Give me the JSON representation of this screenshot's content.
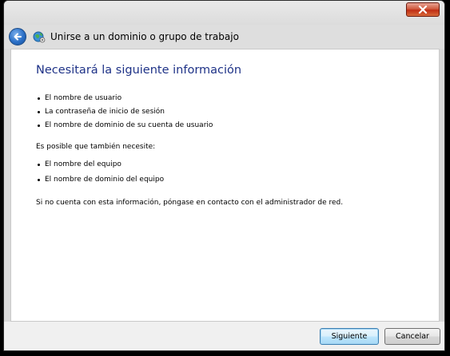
{
  "window": {
    "title": "Unirse a un dominio o grupo de trabajo"
  },
  "icons": {
    "close": "close-icon",
    "back": "back-arrow-icon",
    "app": "network-globe-icon"
  },
  "content": {
    "heading": "Necesitará la siguiente información",
    "required_items": [
      "El nombre de usuario",
      "La contraseña de inicio de sesión",
      "El nombre de dominio de su cuenta de usuario"
    ],
    "optional_intro": "Es posible que también necesite:",
    "optional_items": [
      "El nombre del equipo",
      "El nombre de dominio del equipo"
    ],
    "contact_note": "Si no cuenta con esta información, póngase en contacto con el administrador de red."
  },
  "footer": {
    "next_label": "Siguiente",
    "cancel_label": "Cancelar"
  },
  "colors": {
    "heading": "#1e3287",
    "close_button": "#c02d14",
    "back_button": "#2a6fc7"
  }
}
